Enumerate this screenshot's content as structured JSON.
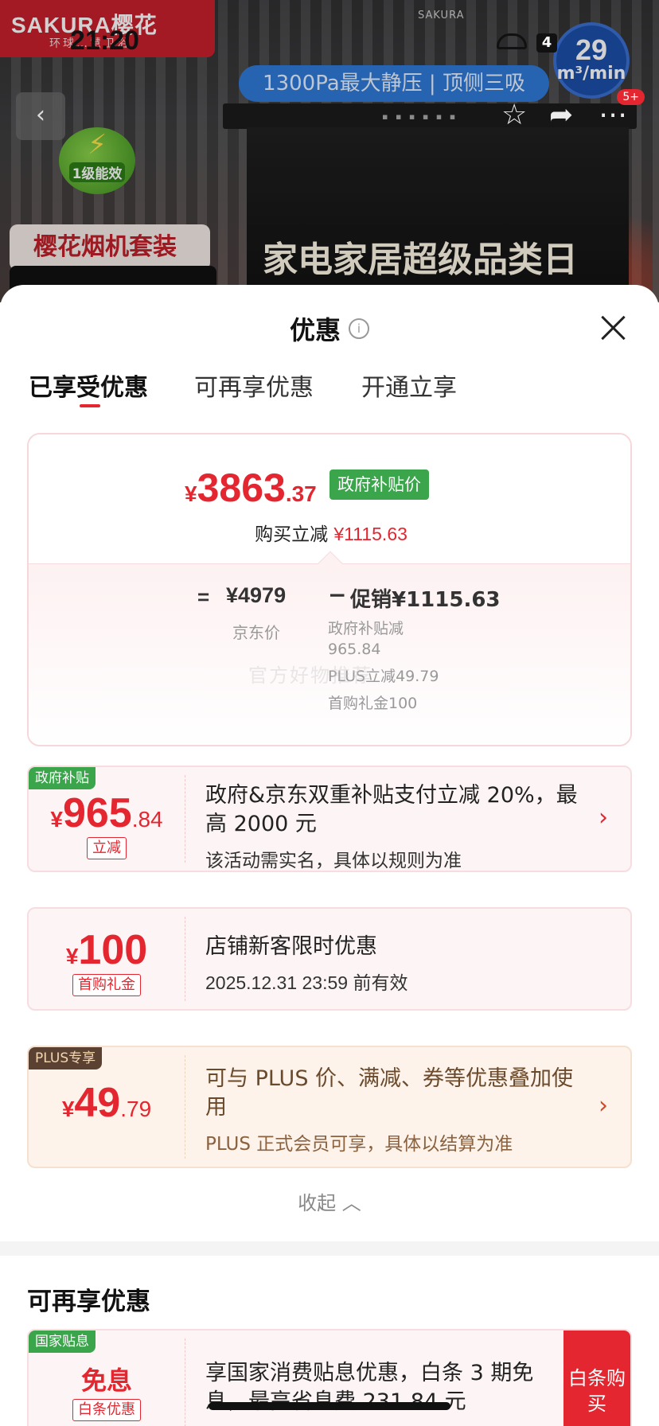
{
  "status_bar": {
    "time": "21:20",
    "battery": "4"
  },
  "background": {
    "brand": "SAKURA樱花",
    "brand_sub": "环球…慧卫浴",
    "product_brand": "SAKURA",
    "airflow_value": "29",
    "airflow_unit": "m³/min",
    "pressure_banner": "1300Pa最大静压 | 顶侧三吸",
    "energy_level": "1级能效",
    "set_label": "樱花烟机套装",
    "promo_text": "家电家居超级品类日",
    "notif_count": "5+"
  },
  "sheet": {
    "title": "优惠",
    "tabs": [
      "已享受优惠",
      "可再享优惠",
      "开通立享"
    ],
    "price_card": {
      "currency": "¥",
      "final_int": "3863",
      "final_dec": ".37",
      "tag": "政府补贴价",
      "instant_label": "购买立减",
      "instant_amount": "¥1115.63",
      "eq": "=",
      "jd_price": "¥4979",
      "jd_label": "京东价",
      "minus": "−",
      "promo_sum": "促销¥1115.63",
      "promo_lines": [
        "政府补贴减\n965.84",
        "PLUS立减49.79",
        "首购礼金100"
      ],
      "watermark": "官方好物推荐"
    },
    "coupons": [
      {
        "ribbon": "政府补贴",
        "currency": "¥",
        "int": "965",
        "dec": ".84",
        "chip": "立减",
        "title": "政府&京东双重补贴支付立减 20%，最高 2000 元",
        "sub": "该活动需实名，具体以规则为准"
      },
      {
        "currency": "¥",
        "int": "100",
        "chip": "首购礼金",
        "title": "店铺新客限时优惠",
        "sub": "2025.12.31 23:59 前有效"
      },
      {
        "ribbon": "PLUS专享",
        "currency": "¥",
        "int": "49",
        "dec": ".79",
        "title": "可与 PLUS 价、满减、券等优惠叠加使用",
        "sub": "PLUS 正式会员可享，具体以结算为准"
      }
    ],
    "collapse_label": "收起 ︿",
    "more_section_title": "可再享优惠",
    "more_coupon": {
      "ribbon": "国家贴息",
      "big": "免息",
      "chip": "白条优惠",
      "title": "享国家消费贴息优惠，白条 3 期免息，最高省息费 231.84 元",
      "button": "白条购买"
    }
  },
  "colors": {
    "accent": "#e3262f",
    "green": "#3aa54a",
    "plus_brown": "#5a4132"
  }
}
